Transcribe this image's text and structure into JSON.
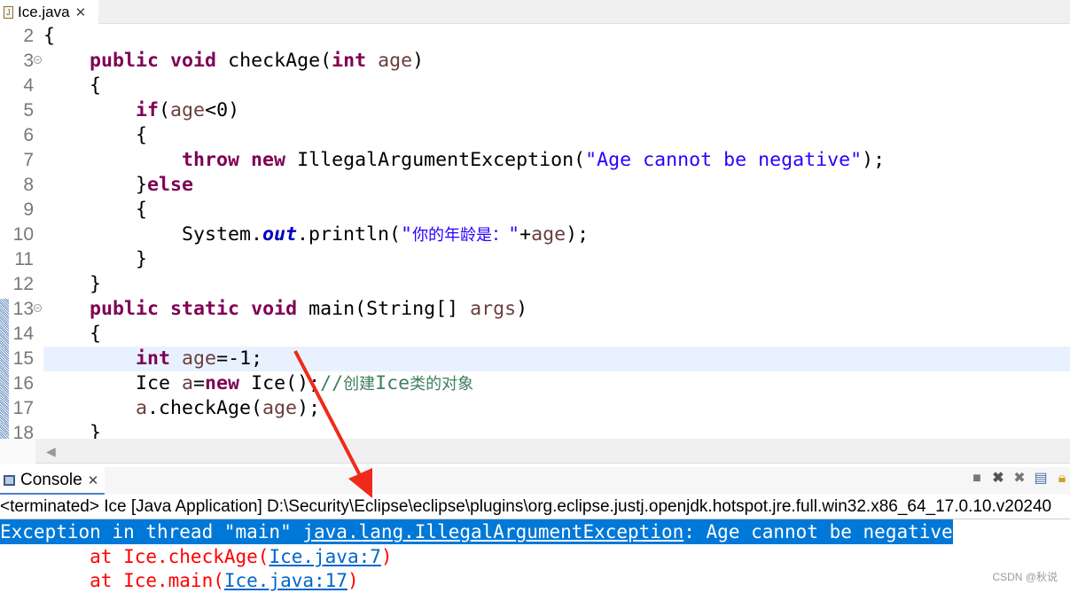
{
  "tab": {
    "title": "Ice.java",
    "icon": "java-file-icon"
  },
  "editor": {
    "current_line": 15,
    "lines": [
      {
        "n": "2",
        "t": [
          [
            "{",
            ""
          ]
        ]
      },
      {
        "n": "3",
        "fold": true,
        "t": [
          [
            "    ",
            ""
          ],
          [
            "public",
            "kw"
          ],
          [
            " ",
            ""
          ],
          [
            "void",
            "kw"
          ],
          [
            " checkAge(",
            ""
          ],
          [
            "int",
            "kw"
          ],
          [
            " ",
            ""
          ],
          [
            "age",
            "var"
          ],
          [
            ")",
            ""
          ]
        ]
      },
      {
        "n": "4",
        "t": [
          [
            "    {",
            ""
          ]
        ]
      },
      {
        "n": "5",
        "t": [
          [
            "        ",
            ""
          ],
          [
            "if",
            "kw"
          ],
          [
            "(",
            ""
          ],
          [
            "age",
            "var"
          ],
          [
            "<0)",
            ""
          ]
        ]
      },
      {
        "n": "6",
        "t": [
          [
            "        {",
            ""
          ]
        ]
      },
      {
        "n": "7",
        "t": [
          [
            "            ",
            ""
          ],
          [
            "throw",
            "kw"
          ],
          [
            " ",
            ""
          ],
          [
            "new",
            "kw"
          ],
          [
            " IllegalArgumentException(",
            ""
          ],
          [
            "\"Age cannot be negative\"",
            "str"
          ],
          [
            ");",
            ""
          ]
        ]
      },
      {
        "n": "8",
        "t": [
          [
            "        }",
            ""
          ],
          [
            "else",
            "kw"
          ]
        ]
      },
      {
        "n": "9",
        "t": [
          [
            "        {",
            ""
          ]
        ]
      },
      {
        "n": "10",
        "t": [
          [
            "            System.",
            ""
          ],
          [
            "out",
            "fld"
          ],
          [
            ".println(",
            ""
          ],
          [
            "\"",
            "str"
          ],
          [
            "你的年龄是：",
            "str cjk"
          ],
          [
            "\"",
            "str"
          ],
          [
            "+",
            ""
          ],
          [
            "age",
            "var"
          ],
          [
            ");",
            ""
          ]
        ]
      },
      {
        "n": "11",
        "t": [
          [
            "        }",
            ""
          ]
        ]
      },
      {
        "n": "12",
        "t": [
          [
            "    }",
            ""
          ]
        ]
      },
      {
        "n": "13",
        "fold": true,
        "t": [
          [
            "    ",
            ""
          ],
          [
            "public",
            "kw"
          ],
          [
            " ",
            ""
          ],
          [
            "static",
            "kw"
          ],
          [
            " ",
            ""
          ],
          [
            "void",
            "kw"
          ],
          [
            " main(String[] ",
            ""
          ],
          [
            "args",
            "var"
          ],
          [
            ")",
            ""
          ]
        ]
      },
      {
        "n": "14",
        "t": [
          [
            "    {",
            ""
          ]
        ]
      },
      {
        "n": "15",
        "t": [
          [
            "        ",
            ""
          ],
          [
            "int",
            "kw"
          ],
          [
            " ",
            ""
          ],
          [
            "age",
            "var"
          ],
          [
            "=-1;",
            ""
          ]
        ]
      },
      {
        "n": "16",
        "t": [
          [
            "        Ice ",
            ""
          ],
          [
            "a",
            "var"
          ],
          [
            "=",
            ""
          ],
          [
            "new",
            "kw"
          ],
          [
            " Ice();",
            ""
          ],
          [
            "//",
            "cm"
          ],
          [
            "创建",
            "cm cjk"
          ],
          [
            "Ice",
            "cm"
          ],
          [
            "类的对象",
            "cm cjk"
          ]
        ]
      },
      {
        "n": "17",
        "t": [
          [
            "        ",
            ""
          ],
          [
            "a",
            "var"
          ],
          [
            ".checkAge(",
            ""
          ],
          [
            "age",
            "var"
          ],
          [
            ");",
            ""
          ]
        ]
      },
      {
        "n": "18",
        "t": [
          [
            "    }",
            ""
          ]
        ]
      }
    ]
  },
  "console": {
    "tab_title": "Console",
    "tab_icon": "console-monitor-icon",
    "toolbar": [
      "terminate-icon",
      "remove-launch-icon",
      "remove-all-terminated-icon",
      "clear-console-icon",
      "scroll-lock-icon"
    ],
    "terminated": "<terminated> Ice [Java Application] D:\\Security\\Eclipse\\eclipse\\plugins\\org.eclipse.justj.openjdk.hotspot.jre.full.win32.x86_64_17.0.10.v20240",
    "exc_prefix": "Exception in thread \"main\" ",
    "exc_class": "java.lang.IllegalArgumentException",
    "exc_msg": ": Age cannot be negative",
    "trace": [
      {
        "at": "        at Ice.checkAge(",
        "link": "Ice.java:7",
        "end": ")"
      },
      {
        "at": "        at Ice.main(",
        "link": "Ice.java:17",
        "end": ")"
      }
    ]
  },
  "watermark": "CSDN @秋说",
  "colors": {
    "keyword": "#7f0055",
    "string": "#2a00ff",
    "comment": "#3f7f5f",
    "selection": "#0078d7",
    "error": "#ff0000",
    "annotation_arrow": "#f02a1a"
  }
}
